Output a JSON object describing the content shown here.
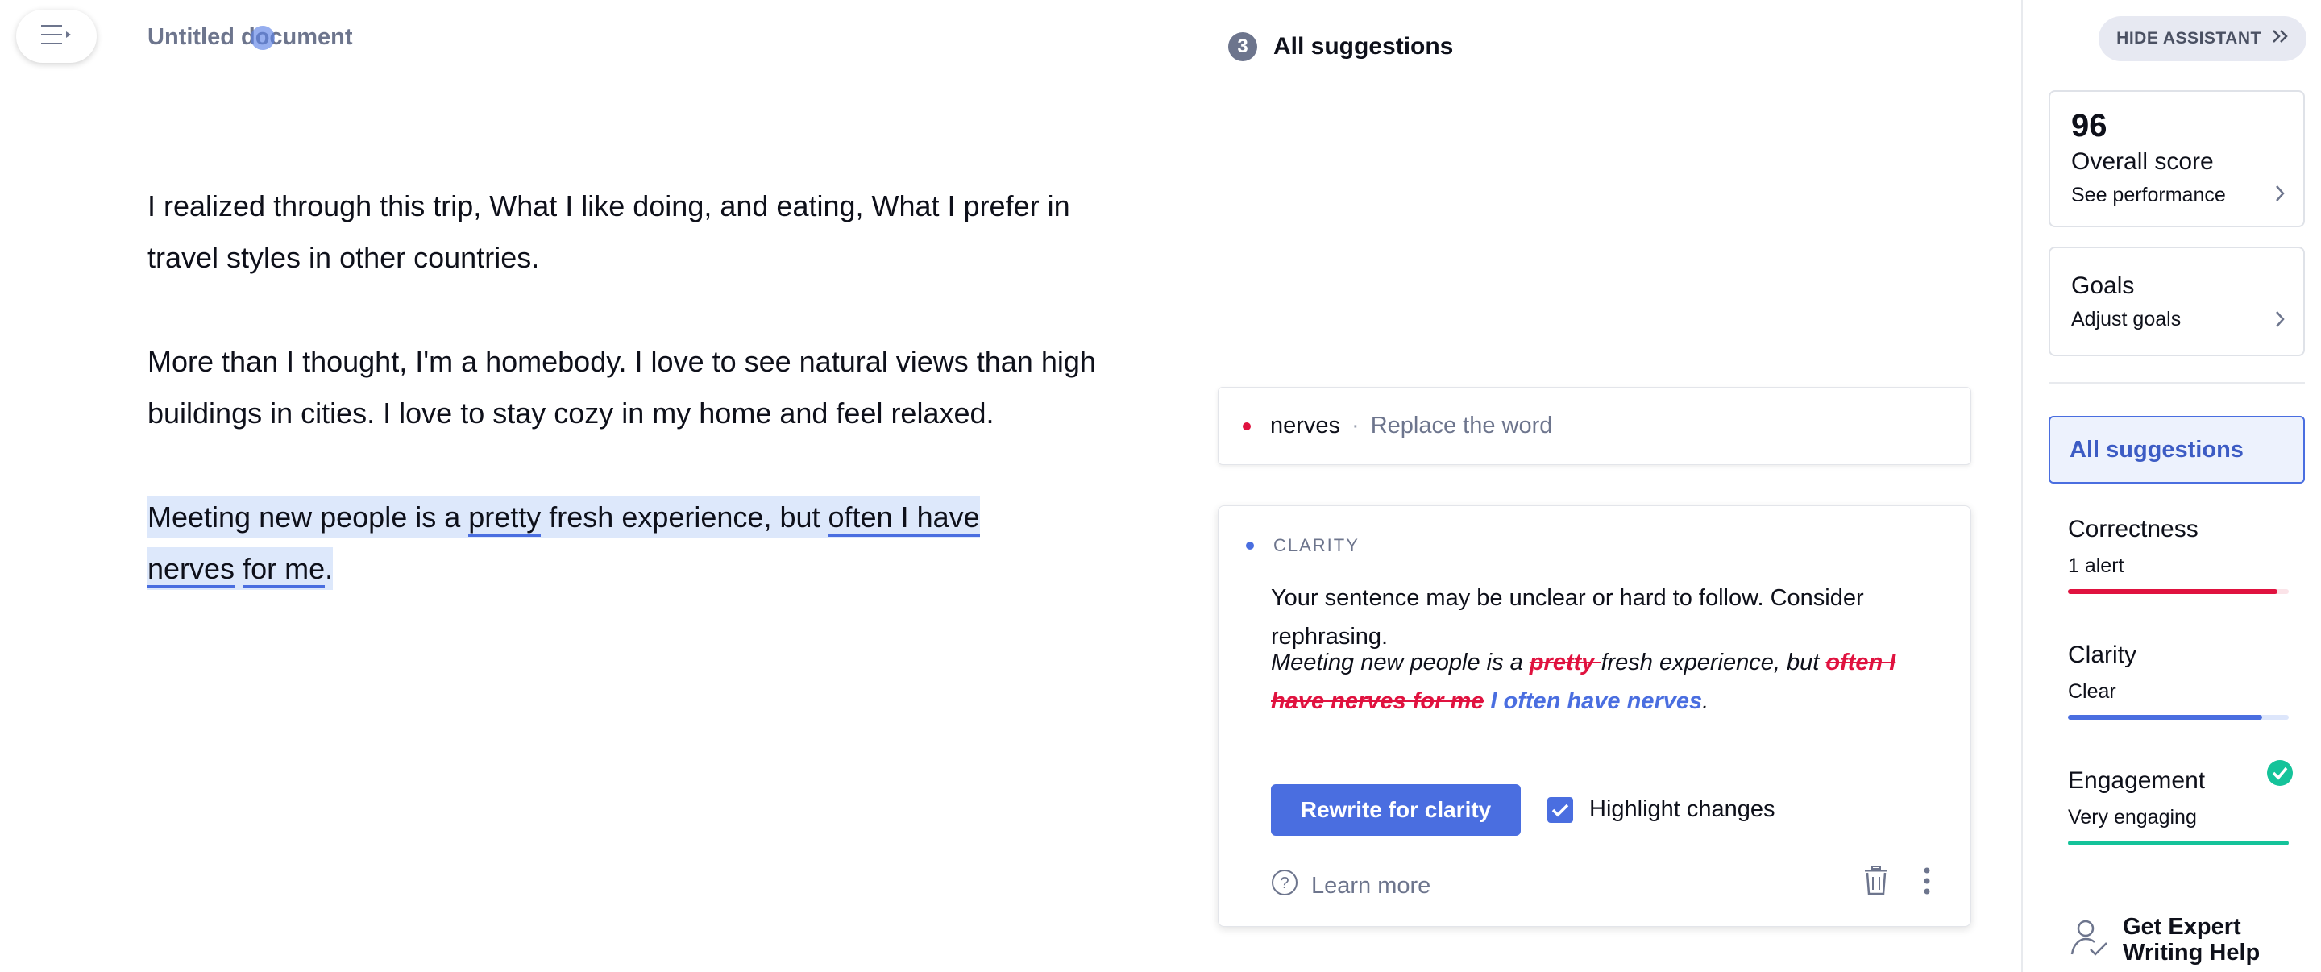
{
  "header": {
    "doc_title": "Untitled document"
  },
  "document": {
    "paragraph1": "I realized through this trip, What I like doing, and eating, What I prefer in travel styles in other countries.",
    "paragraph2": "More than I thought, I'm a homebody. I love to see natural views than high buildings in cities. I love to stay cozy in my home and feel relaxed.",
    "paragraph3": {
      "part1": "Meeting new people is a ",
      "word_pretty": "pretty",
      "part2": " fresh experience, but ",
      "phrase_a": "often I have nerves",
      "phrase_b": "for me",
      "end": "."
    }
  },
  "suggestions": {
    "count": "3",
    "title": "All suggestions",
    "collapsed_card": {
      "word": "nerves",
      "separator": "·",
      "action": "Replace the word"
    },
    "main_card": {
      "category": "CLARITY",
      "description": "Your sentence may be unclear or hard to follow. Consider rephrasing.",
      "example": {
        "text1": "Meeting new people is a ",
        "deleted1": "pretty ",
        "text2": "fresh experience, but ",
        "deleted2": "often I have nerves for me",
        "inserted": " I often have nerves",
        "end": "."
      },
      "rewrite_button": "Rewrite for clarity",
      "highlight_label": "Highlight changes",
      "learn_more": "Learn more"
    }
  },
  "assistant": {
    "hide_button": "HIDE ASSISTANT",
    "score": {
      "value": "96",
      "label": "Overall score",
      "link": "See performance"
    },
    "goals": {
      "label": "Goals",
      "link": "Adjust goals"
    },
    "all_suggestions": "All suggestions",
    "categories": [
      {
        "name": "Correctness",
        "status": "1 alert",
        "fill": 0.95,
        "color": "#e0123f",
        "track": "#fbe3e8"
      },
      {
        "name": "Clarity",
        "status": "Clear",
        "fill": 0.88,
        "color": "#4a6ee0",
        "track": "#dde6fb"
      },
      {
        "name": "Engagement",
        "status": "Very engaging",
        "fill": 1.0,
        "color": "#15c39a",
        "track": "#d5f4ec"
      }
    ],
    "expert_help": "Get Expert Writing Help"
  },
  "colors": {
    "accent": "#4a6ee0",
    "error": "#e0123f",
    "success": "#15c39a",
    "muted": "#6d758d"
  }
}
